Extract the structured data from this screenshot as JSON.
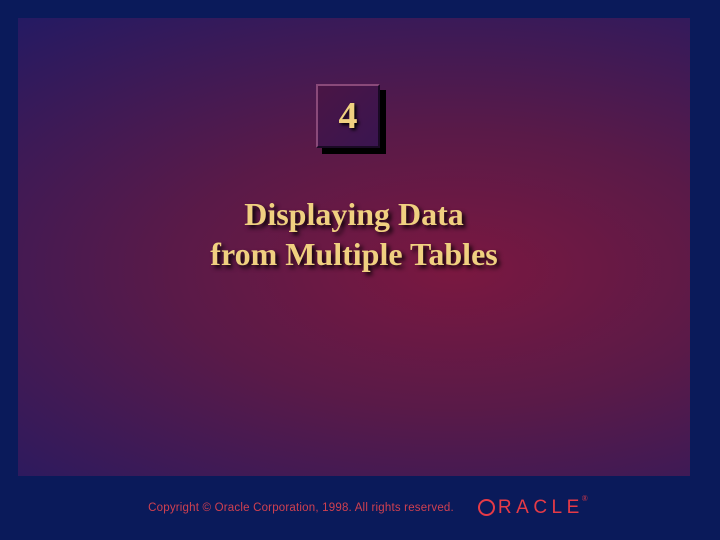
{
  "chapter": {
    "number": "4"
  },
  "title": {
    "line1": "Displaying Data",
    "line2": "from Multiple Tables"
  },
  "footer": {
    "copyright": "Copyright © Oracle Corporation, 1998. All rights reserved.",
    "logo_text": "RACLE",
    "logo_reg": "®"
  }
}
